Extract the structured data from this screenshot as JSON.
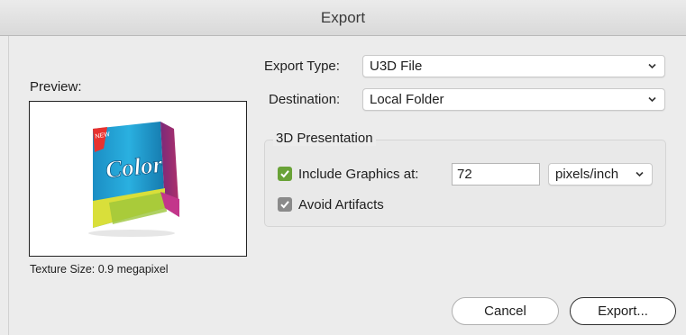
{
  "window": {
    "title": "Export"
  },
  "preview": {
    "label": "Preview:",
    "texture_size": "Texture Size: 0.9 megapixel",
    "package_text": "Color",
    "badge_text": "NEW"
  },
  "export_type": {
    "label": "Export Type:",
    "value": "U3D File"
  },
  "destination": {
    "label": "Destination:",
    "value": "Local Folder"
  },
  "presentation": {
    "title": "3D Presentation",
    "include_graphics": {
      "label": "Include Graphics at:",
      "checked": true,
      "value": "72",
      "unit": "pixels/inch"
    },
    "avoid_artifacts": {
      "label": "Avoid Artifacts",
      "checked": true
    }
  },
  "buttons": {
    "cancel": "Cancel",
    "export": "Export..."
  },
  "colors": {
    "checkbox_green": "#69a237",
    "checkbox_gray": "#8a8a8a"
  },
  "icons": [
    "chevron-down-icon",
    "checkmark-icon"
  ]
}
